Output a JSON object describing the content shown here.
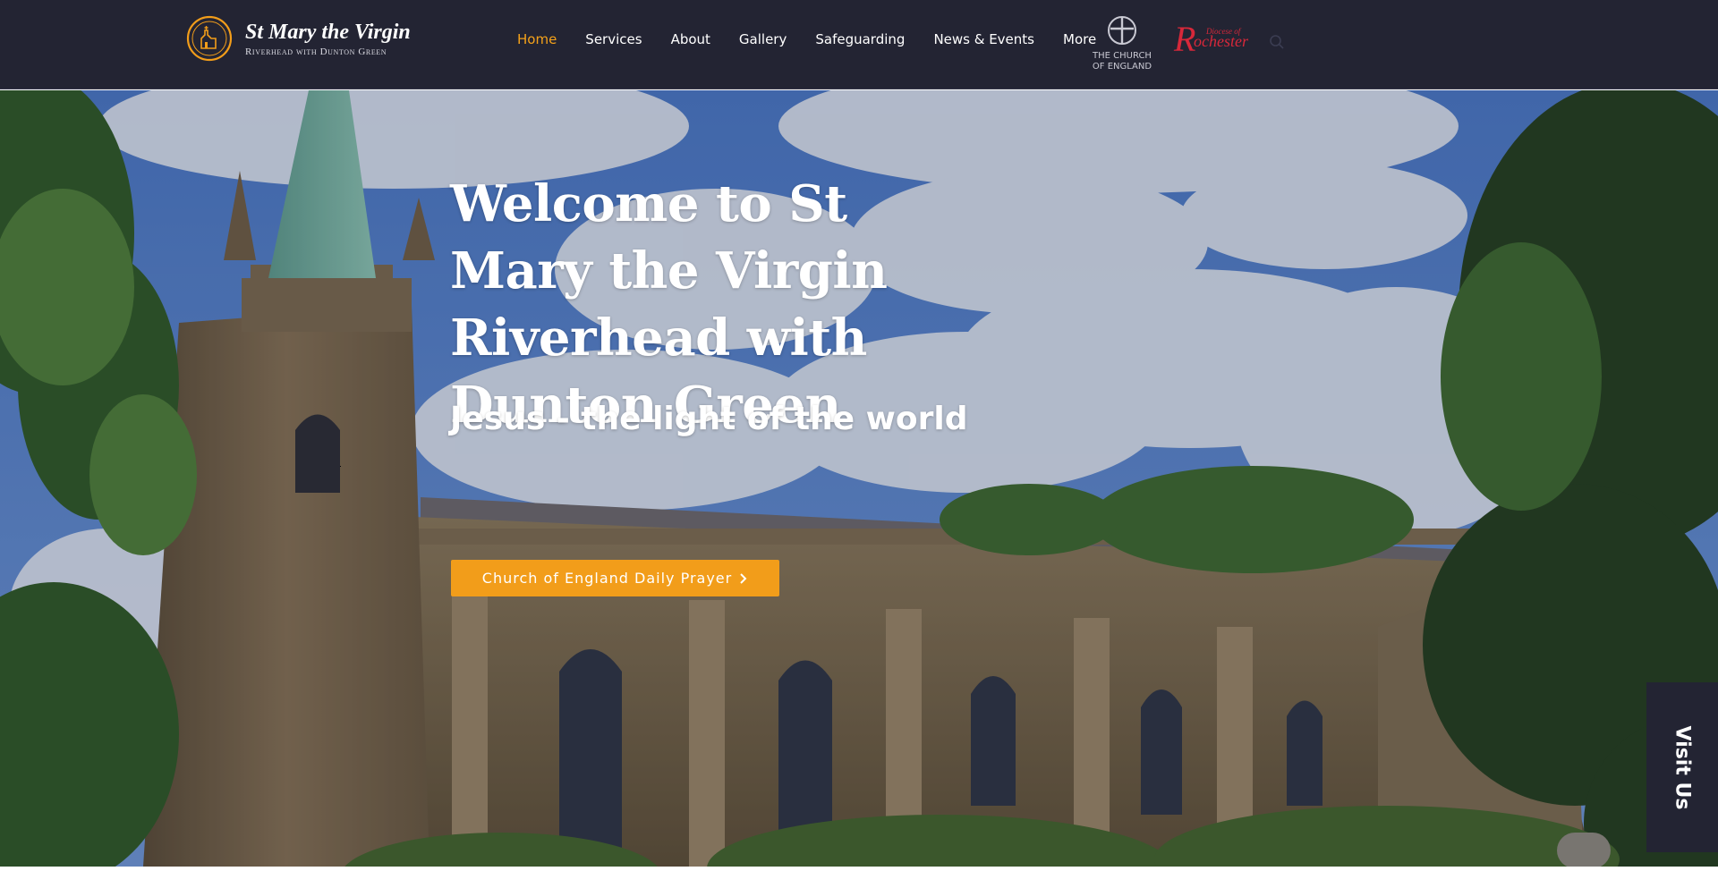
{
  "header": {
    "brand": {
      "name": "St Mary the Virgin",
      "subtitle": "Riverhead with Dunton Green",
      "logo_icon": "church-seal-icon"
    },
    "nav": [
      {
        "label": "Home",
        "active": true
      },
      {
        "label": "Services",
        "active": false
      },
      {
        "label": "About",
        "active": false
      },
      {
        "label": "Gallery",
        "active": false
      },
      {
        "label": "Safeguarding",
        "active": false
      },
      {
        "label": "News & Events",
        "active": false
      },
      {
        "label": "More",
        "active": false
      }
    ],
    "church_of_england_logo": {
      "line1": "THE CHURCH",
      "line2": "OF ENGLAND",
      "icon": "cross-in-circle-icon"
    },
    "diocese_logo": {
      "prefix": "Diocese of",
      "initial": "R",
      "word": "ochester"
    },
    "search_icon": "search-icon"
  },
  "hero": {
    "title": "Welcome to St Mary the Virgin Riverhead with Dunton Green",
    "subtitle": "Jesus - the light of the world",
    "cta_label": "Church of England Daily Prayer",
    "cta_icon": "chevron-right-icon"
  },
  "visit_tab": {
    "label": "Visit Us"
  },
  "colors": {
    "header_bg": "#232433",
    "accent": "#f29d1a",
    "nav_active": "#f5a21a",
    "text_light": "#ffffff",
    "diocese_red": "#d7283a"
  }
}
